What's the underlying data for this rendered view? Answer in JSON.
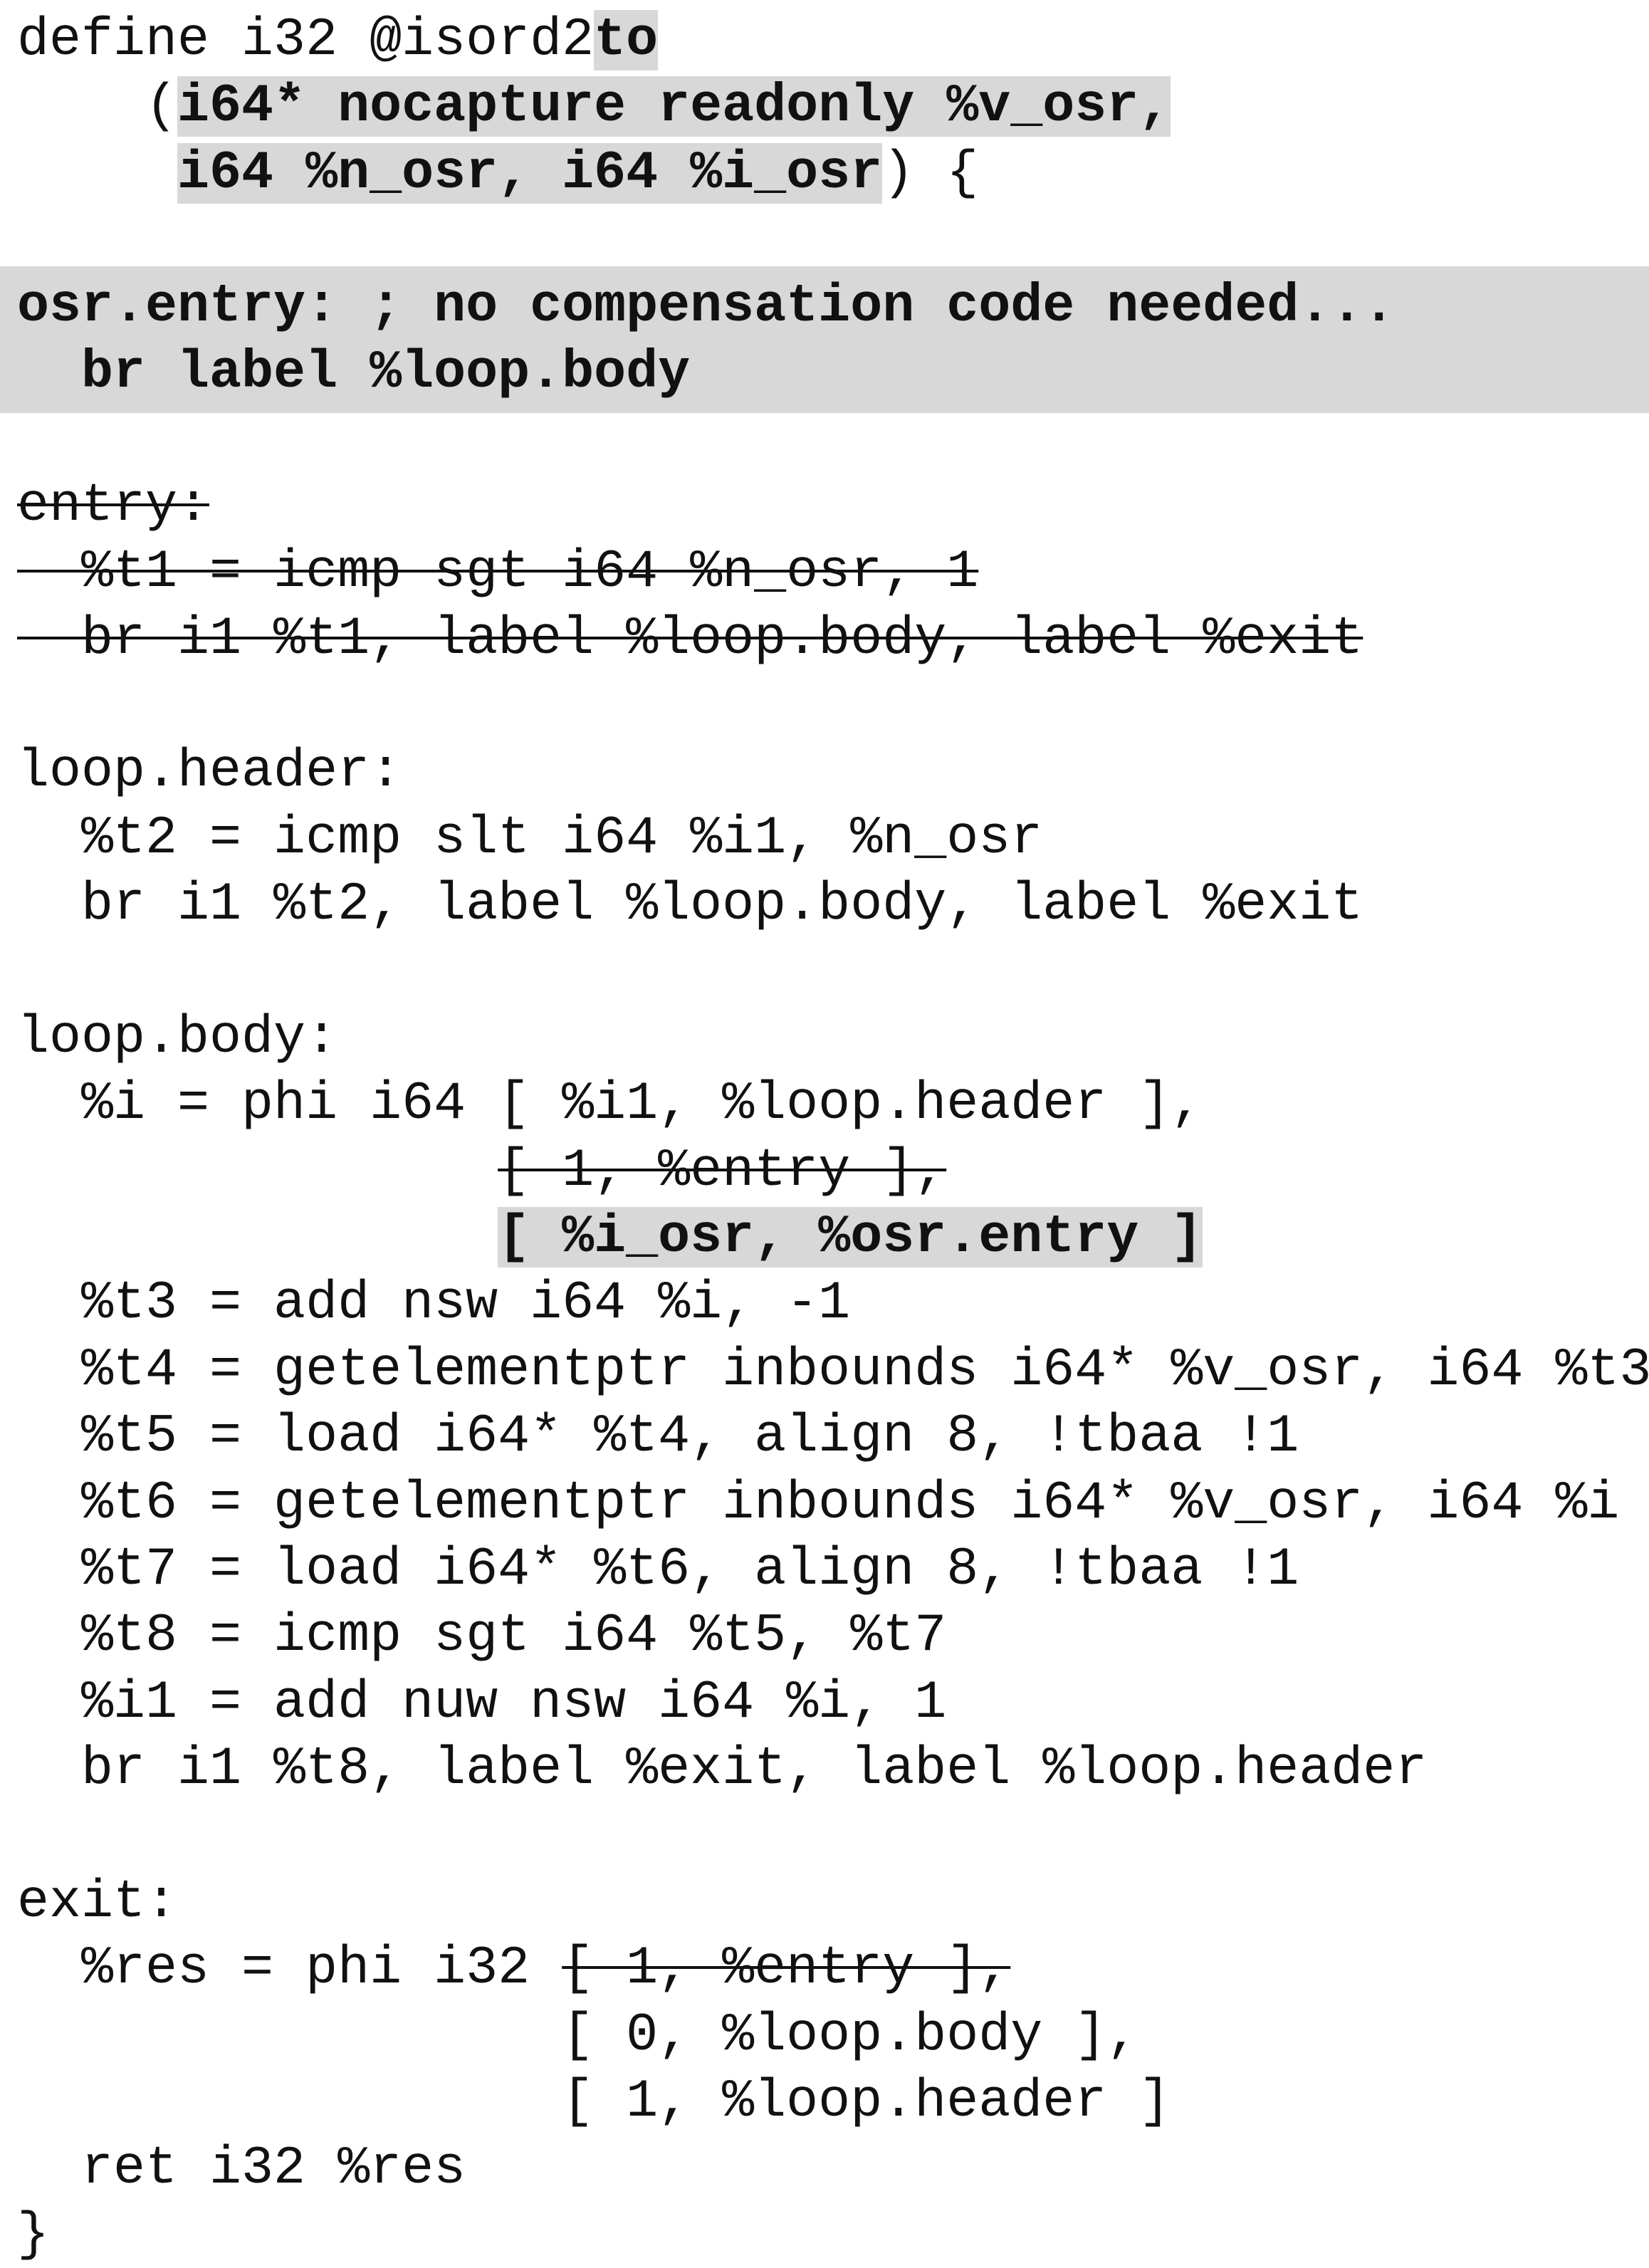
{
  "colors": {
    "text": "#111111",
    "highlight": "#d8d8d8",
    "background": "#ffffff"
  },
  "lines": {
    "l1_a": "define i32 @isord2",
    "l1_b": "to",
    "l2_a": "    (",
    "l2_b": "i64* nocapture readonly %v_osr,",
    "l3_a": "     ",
    "l3_b": "i64 %n_osr, i64 %i_osr",
    "l3_c": ") {",
    "osr_entry_1": "osr.entry: ; no compensation code needed...",
    "osr_entry_2": "  br label %loop.body",
    "entry_1": "entry:",
    "entry_2": "  %t1 = icmp sgt i64 %n_osr, 1",
    "entry_3": "  br i1 %t1, label %loop.body, label %exit",
    "header_1": "loop.header:",
    "header_2": "  %t2 = icmp slt i64 %i1, %n_osr",
    "header_3": "  br i1 %t2, label %loop.body, label %exit",
    "body_1": "loop.body:",
    "body_2": "  %i = phi i64 [ %i1, %loop.header ],",
    "body_3_pad": "               ",
    "body_3": "[ 1, %entry ],",
    "body_4_pad": "               ",
    "body_4": "[ %i_osr, %osr.entry ]",
    "body_5": "  %t3 = add nsw i64 %i, -1",
    "body_6": "  %t4 = getelementptr inbounds i64* %v_osr, i64 %t3",
    "body_7": "  %t5 = load i64* %t4, align 8, !tbaa !1",
    "body_8": "  %t6 = getelementptr inbounds i64* %v_osr, i64 %i",
    "body_9": "  %t7 = load i64* %t6, align 8, !tbaa !1",
    "body_10": "  %t8 = icmp sgt i64 %t5, %t7",
    "body_11": "  %i1 = add nuw nsw i64 %i, 1",
    "body_12": "  br i1 %t8, label %exit, label %loop.header",
    "exit_1": "exit:",
    "exit_2_a": "  %res = phi i32 ",
    "exit_2_b": "[ 1, %entry ],",
    "exit_3": "                 [ 0, %loop.body ],",
    "exit_4": "                 [ 1, %loop.header ]",
    "exit_5": "  ret i32 %res",
    "close": "}"
  }
}
